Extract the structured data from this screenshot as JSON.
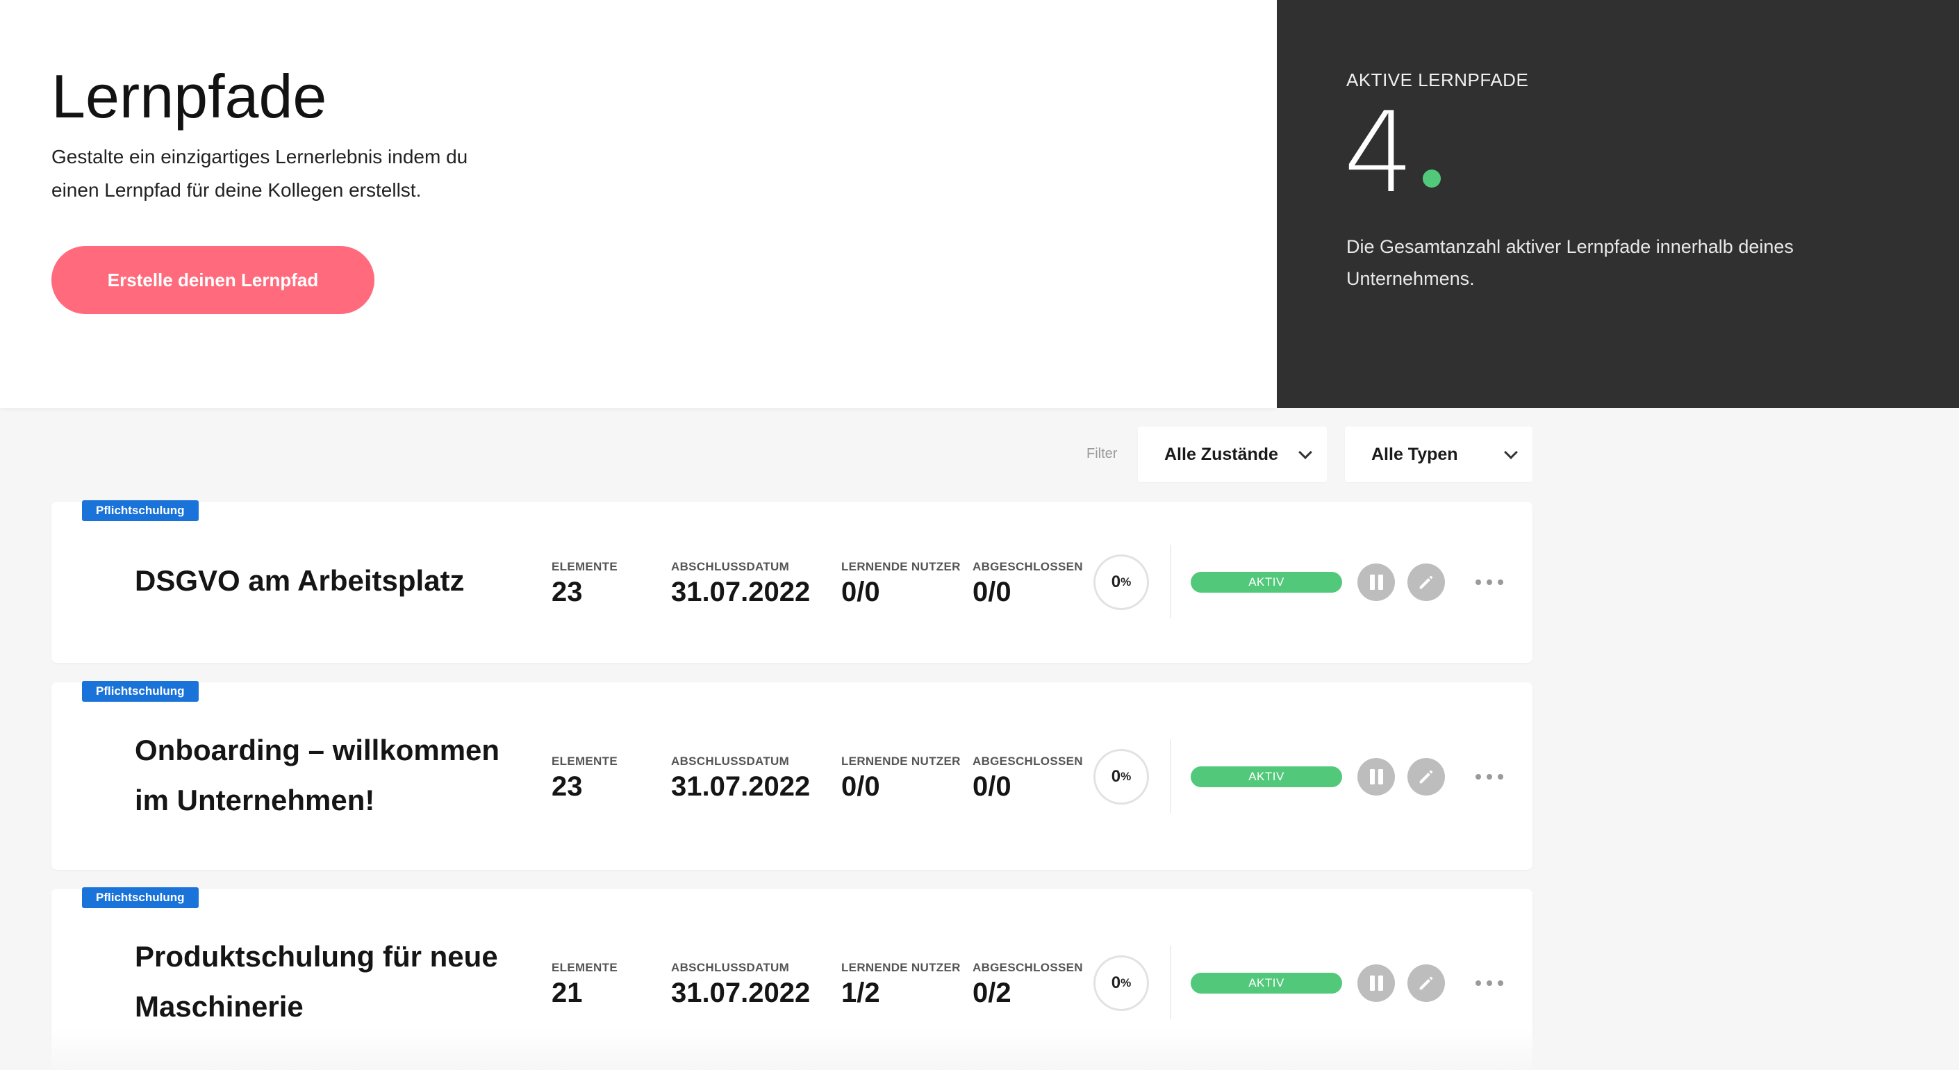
{
  "hero": {
    "title": "Lernpfade",
    "subtitle_line1": "Gestalte ein einzigartiges Lernerlebnis indem du",
    "subtitle_line2": "einen Lernpfad für deine Kollegen erstellst.",
    "create_button": "Erstelle deinen Lernpfad"
  },
  "stats": {
    "label": "AKTIVE LERNPFADE",
    "value": "4",
    "desc_line1": "Die Gesamtanzahl aktiver Lernpfade innerhalb deines",
    "desc_line2": "Unternehmens.",
    "dot_color": "#52c97a"
  },
  "filter": {
    "label": "Filter",
    "state_selected": "Alle Zustände",
    "type_selected": "Alle Typen"
  },
  "labels": {
    "elements": "ELEMENTE",
    "due_date": "ABSCHLUSSDATUM",
    "learners": "LERNENDE NUTZER",
    "completed": "ABGESCHLOSSEN"
  },
  "cards": [
    {
      "badge": "Pflichtschulung",
      "title_line1": "DSGVO am Arbeitsplatz",
      "title_line2": "",
      "elements": "23",
      "due_date": "31.07.2022",
      "learners": "0/0",
      "completed": "0/0",
      "progress_value": "0",
      "progress_unit": "%",
      "status": "AKTIV"
    },
    {
      "badge": "Pflichtschulung",
      "title_line1": "Onboarding – willkommen",
      "title_line2": "im Unternehmen!",
      "elements": "23",
      "due_date": "31.07.2022",
      "learners": "0/0",
      "completed": "0/0",
      "progress_value": "0",
      "progress_unit": "%",
      "status": "AKTIV"
    },
    {
      "badge": "Pflichtschulung",
      "title_line1": "Produktschulung für neue",
      "title_line2": "Maschinerie",
      "elements": "21",
      "due_date": "31.07.2022",
      "learners": "1/2",
      "completed": "0/2",
      "progress_value": "0",
      "progress_unit": "%",
      "status": "AKTIV"
    }
  ],
  "colors": {
    "accent": "#ff6b7c",
    "status_active": "#52c97a",
    "badge": "#1a73d9",
    "dark_panel": "#303030"
  }
}
